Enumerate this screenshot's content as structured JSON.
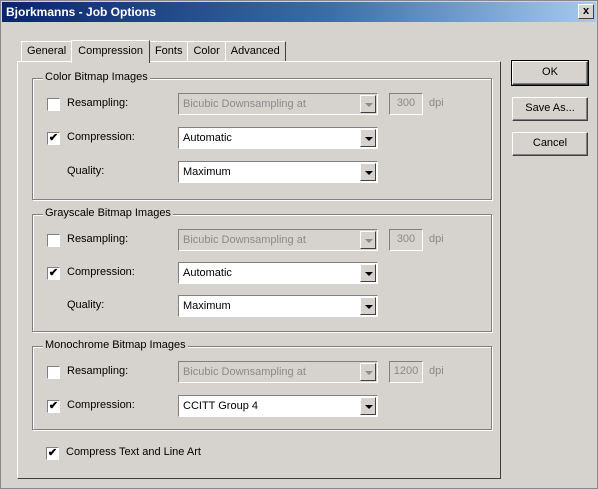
{
  "window": {
    "title": "Bjorkmanns - Job Options",
    "close_label": "x"
  },
  "tabs": [
    {
      "label": "General"
    },
    {
      "label": "Compression"
    },
    {
      "label": "Fonts"
    },
    {
      "label": "Color"
    },
    {
      "label": "Advanced"
    }
  ],
  "active_tab": "Compression",
  "buttons": {
    "ok": "OK",
    "save_as": "Save As...",
    "cancel": "Cancel"
  },
  "color_bitmap": {
    "legend": "Color Bitmap Images",
    "resampling": {
      "label": "Resampling:",
      "checked": false,
      "value": "Bicubic Downsampling at",
      "resolution": "300",
      "unit": "dpi"
    },
    "compression": {
      "label": "Compression:",
      "checked": true,
      "value": "Automatic"
    },
    "quality": {
      "label": "Quality:",
      "value": "Maximum"
    }
  },
  "grayscale_bitmap": {
    "legend": "Grayscale Bitmap Images",
    "resampling": {
      "label": "Resampling:",
      "checked": false,
      "value": "Bicubic Downsampling at",
      "resolution": "300",
      "unit": "dpi"
    },
    "compression": {
      "label": "Compression:",
      "checked": true,
      "value": "Automatic"
    },
    "quality": {
      "label": "Quality:",
      "value": "Maximum"
    }
  },
  "monochrome_bitmap": {
    "legend": "Monochrome Bitmap Images",
    "resampling": {
      "label": "Resampling:",
      "checked": false,
      "value": "Bicubic Downsampling at",
      "resolution": "1200",
      "unit": "dpi"
    },
    "compression": {
      "label": "Compression:",
      "checked": true,
      "value": "CCITT Group 4"
    }
  },
  "compress_text": {
    "label": "Compress Text and Line Art",
    "checked": true
  },
  "check_mark": "✔"
}
